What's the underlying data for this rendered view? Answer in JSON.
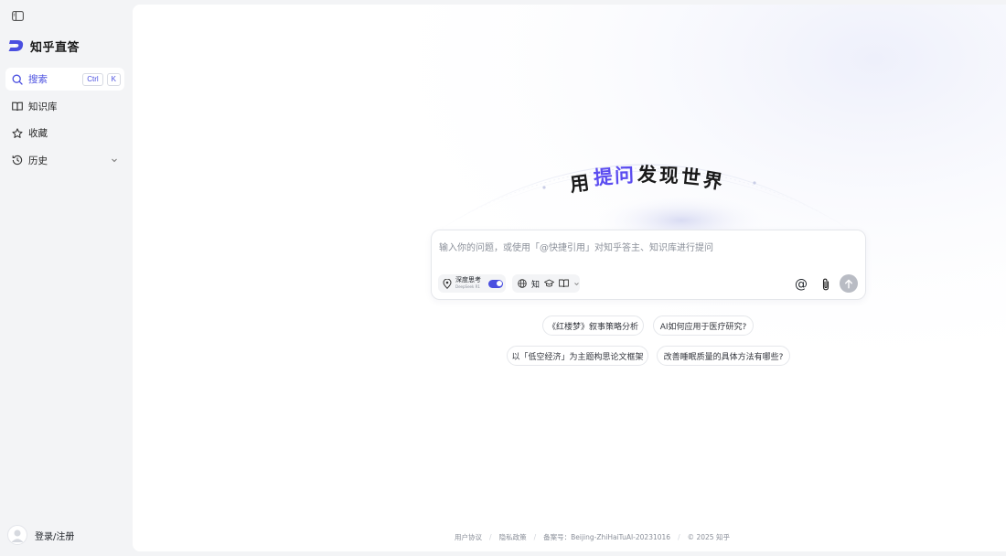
{
  "app": {
    "name": "知乎直答"
  },
  "sidebar": {
    "items": [
      {
        "label": "搜索",
        "icon": "search-icon",
        "active": true,
        "shortcut": [
          "Ctrl",
          "K"
        ]
      },
      {
        "label": "知识库",
        "icon": "book-icon"
      },
      {
        "label": "收藏",
        "icon": "star-icon"
      },
      {
        "label": "历史",
        "icon": "history-icon",
        "expandable": true
      }
    ],
    "login_label": "登录/注册"
  },
  "hero": {
    "chars": [
      "用",
      "提",
      "问",
      "发",
      "现",
      "世",
      "界"
    ],
    "accent_indices": [
      1,
      2
    ]
  },
  "composer": {
    "placeholder": "输入你的问题，或使用「@快捷引用」对知乎答主、知识库进行提问",
    "deep_think_label": "深度思考",
    "deep_think_sub": "DeepSeek R1",
    "deep_think_on": true,
    "source_label": "知",
    "send_icon": "arrow-up-icon"
  },
  "suggestions": [
    "《红楼梦》叙事策略分析",
    "AI如何应用于医疗研究?",
    "以「低空经济」为主题构思论文框架",
    "改善睡眠质量的具体方法有哪些?"
  ],
  "footer": {
    "links": [
      "用户协议",
      "隐私政策",
      "备案号：Beijing-ZhiHaiTuAI-20231016",
      "© 2025 知乎"
    ]
  },
  "colors": {
    "accent": "#4a4fe0",
    "hero_accent": "#5b4cf0",
    "sidebar_bg": "#f3f4f6",
    "send_disabled": "#b9bcc4"
  }
}
